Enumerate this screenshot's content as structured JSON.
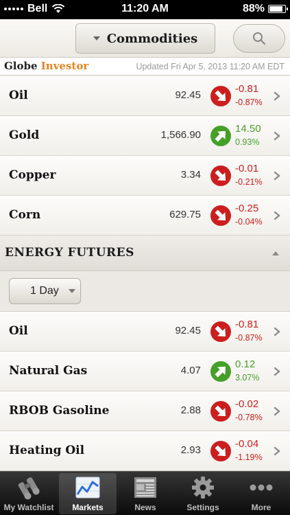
{
  "status_bar": {
    "carrier": "Bell",
    "time": "11:20 AM",
    "battery": "88%",
    "battery_level": 0.88
  },
  "nav": {
    "title": "Commodities",
    "search_icon": "search-icon"
  },
  "source": {
    "brand_part1": "Globe",
    "brand_part2": "Investor",
    "updated": "Updated Fri Apr 5, 2013 11:20 AM EDT",
    "accent_color": "#e6841f"
  },
  "commodities": [
    {
      "name": "Oil",
      "price": "92.45",
      "change": "-0.81",
      "pct": "-0.87%",
      "direction": "down"
    },
    {
      "name": "Gold",
      "price": "1,566.90",
      "change": "14.50",
      "pct": "0.93%",
      "direction": "up"
    },
    {
      "name": "Copper",
      "price": "3.34",
      "change": "-0.01",
      "pct": "-0.21%",
      "direction": "down"
    },
    {
      "name": "Corn",
      "price": "629.75",
      "change": "-0.25",
      "pct": "-0.04%",
      "direction": "down"
    }
  ],
  "section": {
    "title": "ENERGY FUTURES",
    "period": "1 Day"
  },
  "energy": [
    {
      "name": "Oil",
      "price": "92.45",
      "change": "-0.81",
      "pct": "-0.87%",
      "direction": "down"
    },
    {
      "name": "Natural Gas",
      "price": "4.07",
      "change": "0.12",
      "pct": "3.07%",
      "direction": "up"
    },
    {
      "name": "RBOB Gasoline",
      "price": "2.88",
      "change": "-0.02",
      "pct": "-0.78%",
      "direction": "down"
    },
    {
      "name": "Heating Oil",
      "price": "2.93",
      "change": "-0.04",
      "pct": "-1.19%",
      "direction": "down"
    }
  ],
  "tabs": [
    {
      "label": "My Watchlist",
      "icon": "binoculars-icon",
      "active": false
    },
    {
      "label": "Markets",
      "icon": "chart-icon",
      "active": true
    },
    {
      "label": "News",
      "icon": "newspaper-icon",
      "active": false
    },
    {
      "label": "Settings",
      "icon": "gear-icon",
      "active": false
    },
    {
      "label": "More",
      "icon": "more-icon",
      "active": false
    }
  ],
  "colors": {
    "down": "#cc1e1e",
    "up": "#45a028"
  }
}
